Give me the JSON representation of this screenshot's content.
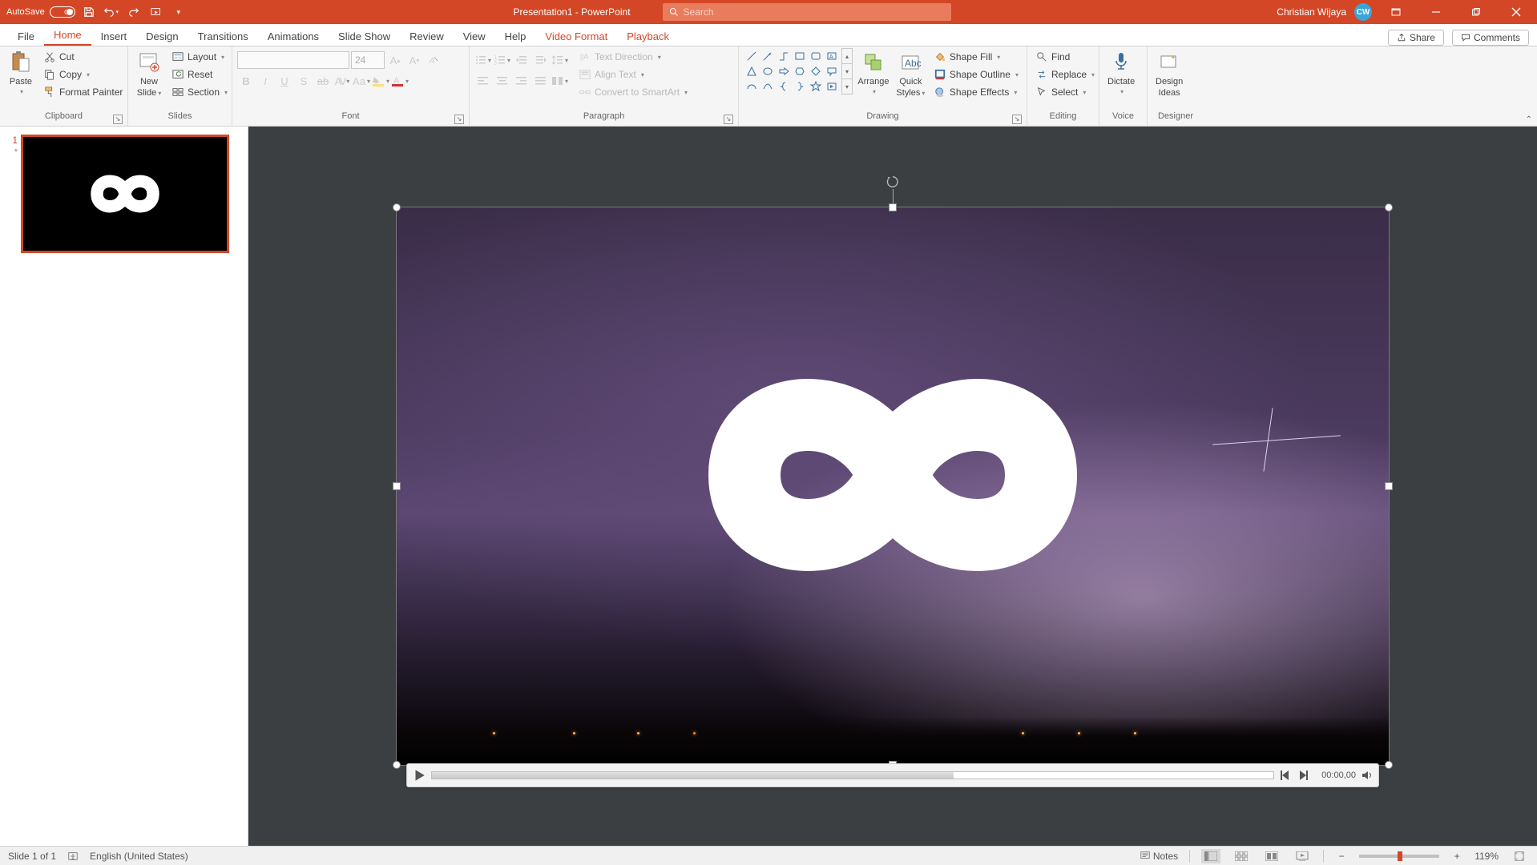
{
  "titlebar": {
    "autosave_label": "AutoSave",
    "autosave_state": "Off",
    "doc_title": "Presentation1 - PowerPoint",
    "search_placeholder": "Search",
    "user_name": "Christian Wijaya",
    "user_initials": "CW"
  },
  "tabs": {
    "items": [
      "File",
      "Home",
      "Insert",
      "Design",
      "Transitions",
      "Animations",
      "Slide Show",
      "Review",
      "View",
      "Help",
      "Video Format",
      "Playback"
    ],
    "active": "Home",
    "share": "Share",
    "comments": "Comments"
  },
  "ribbon": {
    "clipboard": {
      "label": "Clipboard",
      "paste": "Paste",
      "cut": "Cut",
      "copy": "Copy",
      "format_painter": "Format Painter"
    },
    "slides": {
      "label": "Slides",
      "new_slide": "New\nSlide",
      "new_slide_line1": "New",
      "new_slide_line2": "Slide",
      "layout": "Layout",
      "reset": "Reset",
      "section": "Section"
    },
    "font": {
      "label": "Font",
      "size": "24"
    },
    "paragraph": {
      "label": "Paragraph",
      "text_direction": "Text Direction",
      "align_text": "Align Text",
      "convert_smartart": "Convert to SmartArt"
    },
    "drawing": {
      "label": "Drawing",
      "arrange": "Arrange",
      "quick_styles": "Quick\nStyles",
      "quick_styles_line1": "Quick",
      "quick_styles_line2": "Styles",
      "shape_fill": "Shape Fill",
      "shape_outline": "Shape Outline",
      "shape_effects": "Shape Effects"
    },
    "editing": {
      "label": "Editing",
      "find": "Find",
      "replace": "Replace",
      "select": "Select"
    },
    "voice": {
      "label": "Voice",
      "dictate": "Dictate"
    },
    "designer": {
      "label": "Designer",
      "design_ideas": "Design\nIdeas",
      "design_ideas_line1": "Design",
      "design_ideas_line2": "Ideas"
    }
  },
  "thumbs": {
    "items": [
      {
        "num": "1",
        "marker": "*"
      }
    ]
  },
  "video": {
    "time": "00:00,00"
  },
  "status": {
    "slide_info": "Slide 1 of 1",
    "language": "English (United States)",
    "notes": "Notes",
    "zoom": "119%"
  }
}
